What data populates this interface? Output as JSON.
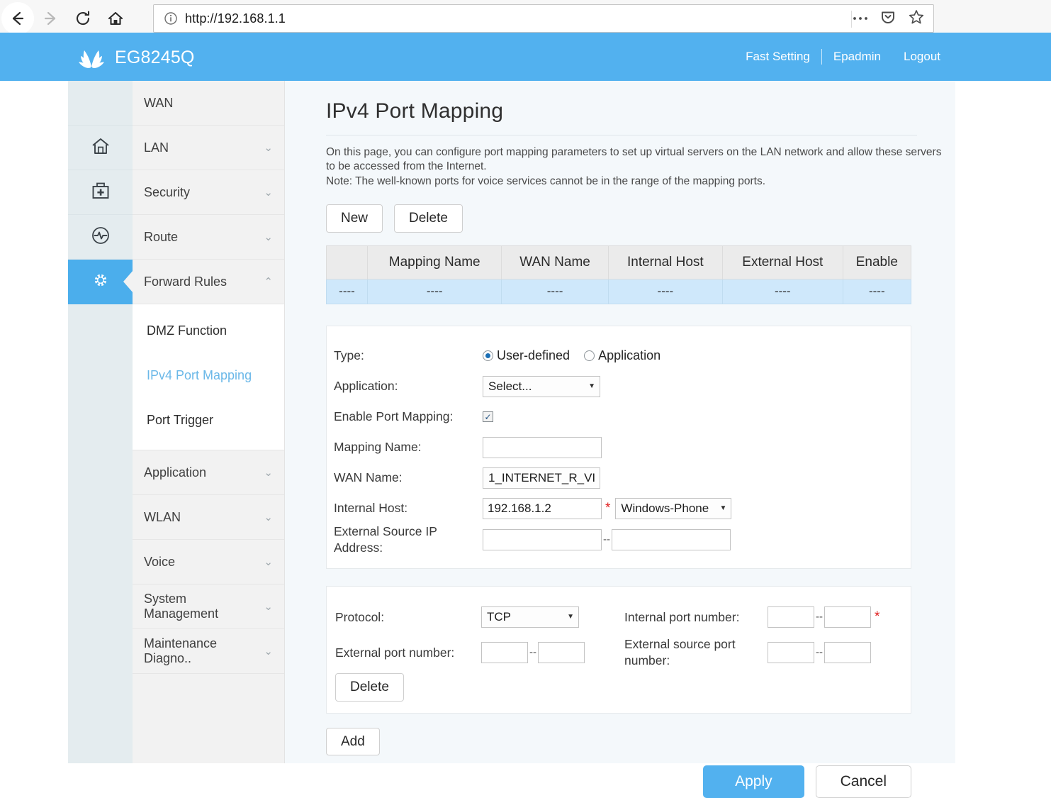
{
  "browser": {
    "back_icon": "back-arrow-icon",
    "forward_icon": "forward-arrow-icon",
    "reload_icon": "reload-icon",
    "home_icon": "home-icon",
    "url": "http://192.168.1.1",
    "url_info_icon": "info-icon",
    "menu_icon": "ellipsis-icon",
    "pocket_icon": "pocket-icon",
    "bookmark_icon": "star-icon"
  },
  "header": {
    "logo_icon": "huawei-logo-icon",
    "device_model": "EG8245Q",
    "links": [
      "Fast Setting",
      "Epadmin",
      "Logout"
    ]
  },
  "sidebar": {
    "rail_icons": [
      "home-icon",
      "toolbox-plus-icon",
      "pulse-circle-icon",
      "gear-icon"
    ],
    "items": [
      {
        "label": "WAN",
        "chevron": ""
      },
      {
        "label": "LAN",
        "chevron": "⌄"
      },
      {
        "label": "Security",
        "chevron": "⌄"
      },
      {
        "label": "Route",
        "chevron": "⌄"
      },
      {
        "label": "Forward Rules",
        "chevron": "⌃"
      }
    ],
    "submenu": [
      {
        "label": "DMZ Function",
        "active": false
      },
      {
        "label": "IPv4 Port Mapping",
        "active": true
      },
      {
        "label": "Port Trigger",
        "active": false
      }
    ],
    "items_after": [
      {
        "label": "Application",
        "chevron": "⌄"
      },
      {
        "label": "WLAN",
        "chevron": "⌄"
      },
      {
        "label": "Voice",
        "chevron": "⌄"
      },
      {
        "label": "System Management",
        "chevron": "⌄"
      },
      {
        "label": "Maintenance Diagno..",
        "chevron": "⌄"
      }
    ]
  },
  "main": {
    "title": "IPv4 Port Mapping",
    "description_line1": "On this page, you can configure port mapping parameters to set up virtual servers on the LAN network and allow these servers",
    "description_line2": "to be accessed from the Internet.",
    "description_line3": "Note: The well-known ports for voice services cannot be in the range of the mapping ports.",
    "new_button": "New",
    "delete_button": "Delete",
    "table": {
      "columns": [
        "",
        "Mapping Name",
        "WAN Name",
        "Internal Host",
        "External Host",
        "Enable"
      ],
      "rows": [
        [
          "----",
          "----",
          "----",
          "----",
          "----",
          "----"
        ]
      ]
    },
    "form": {
      "type_label": "Type:",
      "type_options": [
        "User-defined",
        "Application"
      ],
      "type_selected": "User-defined",
      "application_label": "Application:",
      "application_value": "Select...",
      "enable_label": "Enable Port Mapping:",
      "enable_checked": true,
      "check_glyph": "✓",
      "mapping_name_label": "Mapping Name:",
      "mapping_name_value": "",
      "wan_name_label": "WAN Name:",
      "wan_name_value": "1_INTERNET_R_VI",
      "internal_host_label": "Internal Host:",
      "internal_host_value": "192.168.1.2",
      "internal_host_device": "Windows-Phone",
      "external_source_ip_label": "External Source IP Address:",
      "external_source_ip_start": "",
      "external_source_ip_end": "",
      "required_mark": "*",
      "range_separator": "--"
    },
    "ports": {
      "protocol_label": "Protocol:",
      "protocol_value": "TCP",
      "internal_port_label": "Internal port number:",
      "internal_port_start": "",
      "internal_port_end": "",
      "external_port_label": "External port number:",
      "external_port_start": "",
      "external_port_end": "",
      "external_source_port_label": "External source port number:",
      "external_source_port_start": "",
      "external_source_port_end": "",
      "delete_button": "Delete"
    },
    "add_button": "Add",
    "apply_button": "Apply",
    "cancel_button": "Cancel"
  },
  "colors": {
    "brand_blue": "#52b1ef",
    "active_rail": "#4baeec",
    "table_row": "#cfe8fb",
    "required_red": "#e02020",
    "active_link": "#6bb8e8"
  }
}
